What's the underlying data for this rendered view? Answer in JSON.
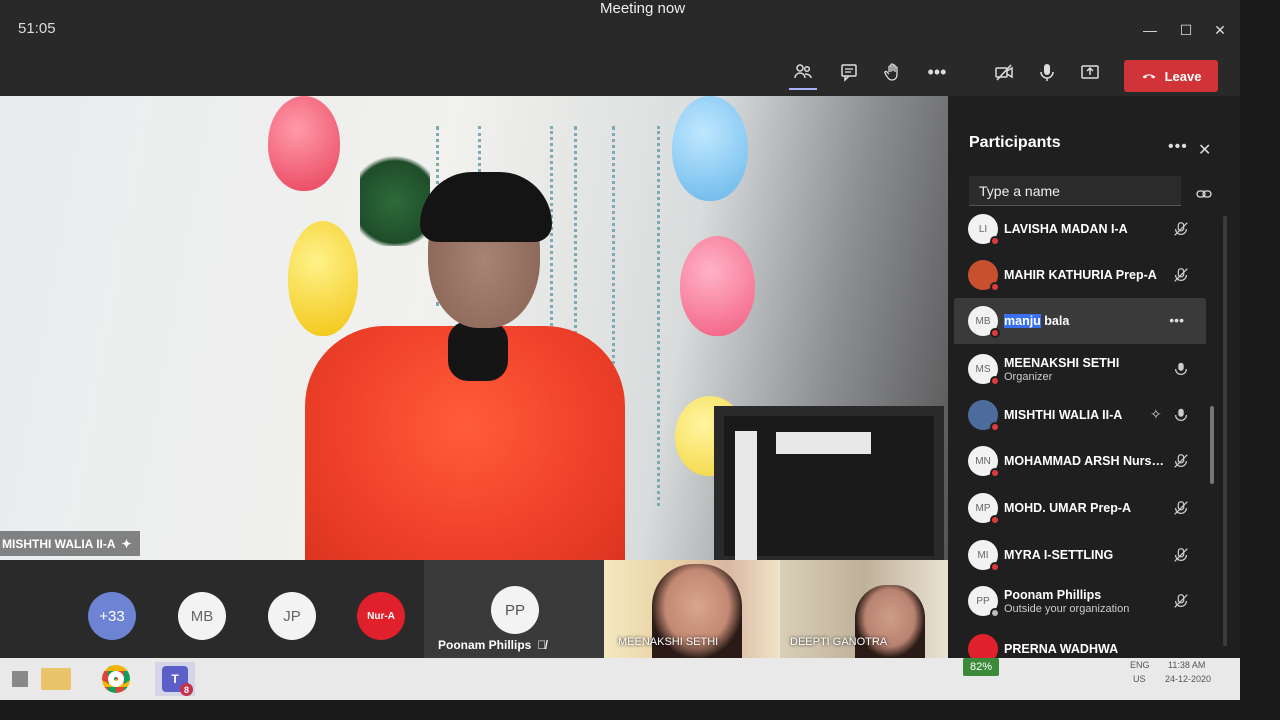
{
  "titlebar": {
    "timer": "51:05",
    "title": "Meeting now"
  },
  "toolbar": {
    "leave_label": "Leave"
  },
  "main_video": {
    "speaker_name": "MISHTHI WALIA II-A"
  },
  "strip": {
    "overflow_count": "+33",
    "avatars": [
      "MB",
      "JP"
    ],
    "logo_text": "Nur-A",
    "tiles": [
      {
        "initials": "PP",
        "name": "Poonam Phillips"
      },
      {
        "name": "MEENAKSHI SETHI"
      },
      {
        "name": "DEEPTI GANOTRA"
      }
    ]
  },
  "participants": {
    "title": "Participants",
    "search_placeholder": "Type a name",
    "rows": [
      {
        "initials": "LI",
        "name": "LAVISHA MADAN I-A",
        "sub": "",
        "mic": "muted"
      },
      {
        "initials": "",
        "name": "MAHIR KATHURIA Prep-A",
        "sub": "",
        "mic": "muted"
      },
      {
        "initials": "MB",
        "name_highlight": "manju",
        "name_rest": " bala",
        "sub": "",
        "mic": "none"
      },
      {
        "initials": "MS",
        "name": "MEENAKSHI SETHI",
        "sub": "Organizer",
        "mic": "on"
      },
      {
        "initials": "",
        "name": "MISHTHI WALIA II-A",
        "sub": "",
        "mic": "on"
      },
      {
        "initials": "MN",
        "name": "MOHAMMAD ARSH Nurse...",
        "sub": "",
        "mic": "muted"
      },
      {
        "initials": "MP",
        "name": "MOHD. UMAR Prep-A",
        "sub": "",
        "mic": "muted"
      },
      {
        "initials": "MI",
        "name": "MYRA I-SETTLING",
        "sub": "",
        "mic": "muted"
      },
      {
        "initials": "PP",
        "name": "Poonam Phillips",
        "sub": "Outside your organization",
        "mic": "muted"
      },
      {
        "initials": "",
        "name": "PRERNA WADHWA",
        "sub": "",
        "mic": "muted"
      }
    ]
  },
  "taskbar": {
    "battery": "82%",
    "lang": "ENG",
    "region": "US",
    "time": "11:38 AM",
    "date": "24-12-2020",
    "teams_badge": "8"
  },
  "colors": {
    "leave": "#d13438",
    "status_red": "#e03b3b",
    "highlight": "#3a6ff0"
  }
}
